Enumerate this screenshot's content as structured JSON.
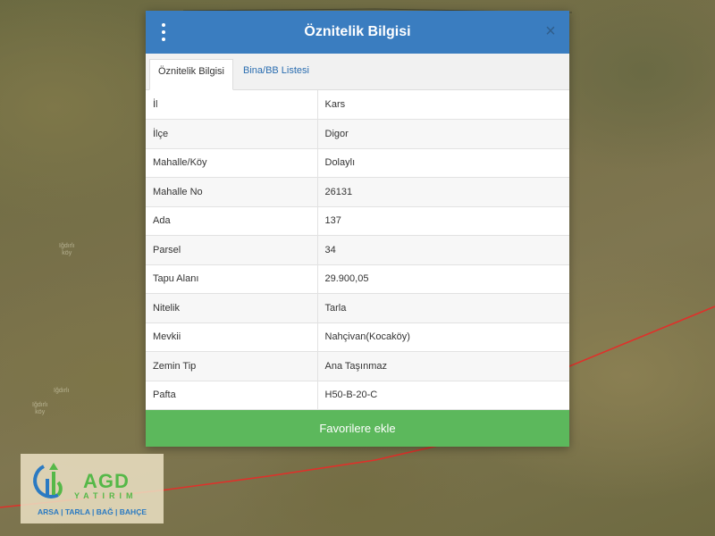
{
  "map": {
    "labels": [
      {
        "name": "map-label-1",
        "lines": [
          "Iğdırlı",
          "köy"
        ]
      },
      {
        "name": "map-label-2",
        "lines": [
          "Iğdırlı"
        ]
      },
      {
        "name": "map-label-3",
        "lines": [
          "Iğdırlı",
          "köy"
        ]
      }
    ]
  },
  "modal": {
    "title": "Öznitelik Bilgisi",
    "close_symbol": "×",
    "tabs": [
      {
        "label": "Öznitelik Bilgisi",
        "active": true
      },
      {
        "label": "Bina/BB Listesi",
        "active": false
      }
    ],
    "rows": [
      {
        "key": "İl",
        "value": "Kars"
      },
      {
        "key": "İlçe",
        "value": "Digor"
      },
      {
        "key": "Mahalle/Köy",
        "value": "Dolaylı"
      },
      {
        "key": "Mahalle No",
        "value": "26131"
      },
      {
        "key": "Ada",
        "value": "137"
      },
      {
        "key": "Parsel",
        "value": "34"
      },
      {
        "key": "Tapu Alanı",
        "value": "29.900,05"
      },
      {
        "key": "Nitelik",
        "value": "Tarla"
      },
      {
        "key": "Mevkii",
        "value": "Nahçivan(Kocaköy)"
      },
      {
        "key": "Zemin Tip",
        "value": "Ana Taşınmaz"
      },
      {
        "key": "Pafta",
        "value": "H50-B-20-C"
      }
    ],
    "favorite_button": "Favorilere ekle"
  },
  "logo": {
    "brand": "AGD",
    "sub": "YATIRIM",
    "tagline": "ARSA | TARLA | BAĞ | BAHÇE"
  },
  "colors": {
    "header_blue": "#3a7dc0",
    "favorite_green": "#5cb85c",
    "boundary_red": "#e0302a",
    "logo_green": "#55b848",
    "logo_blue": "#2a7ac2"
  }
}
